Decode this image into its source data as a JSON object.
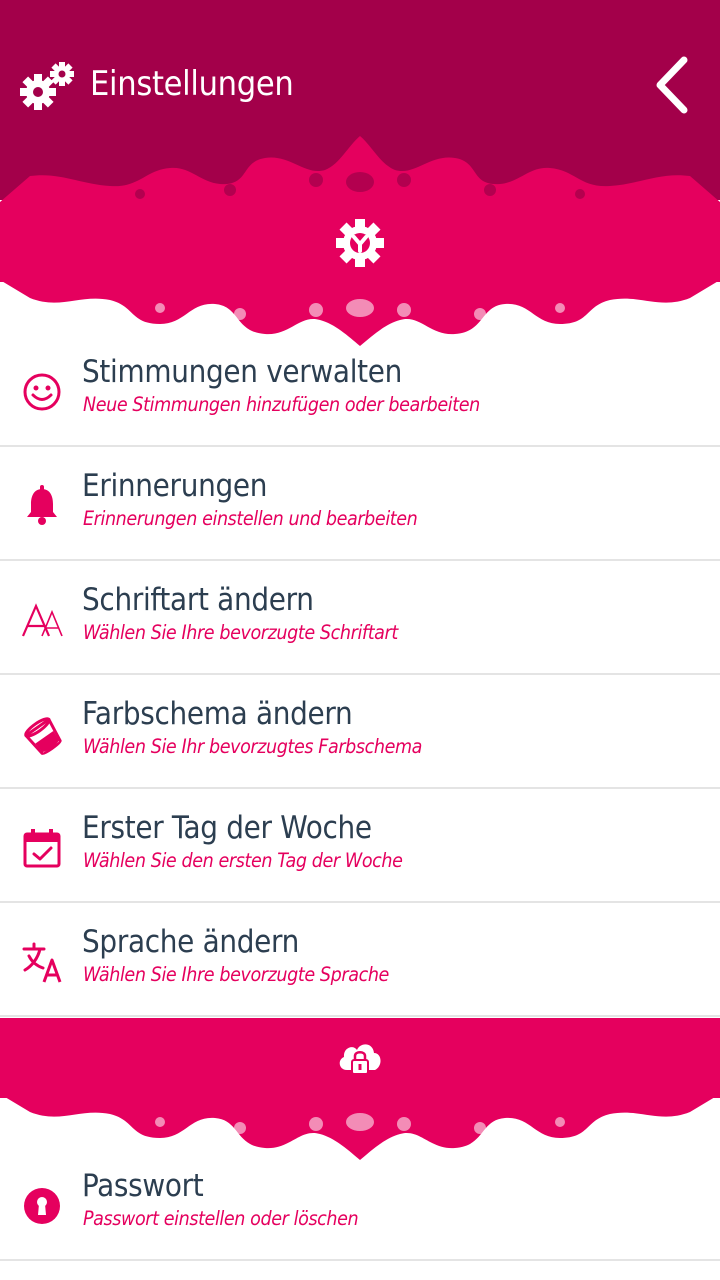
{
  "header": {
    "title": "Einstellungen",
    "bg_color": "#a3004a",
    "icon": "gears-icon",
    "back_icon": "chevron-left-icon"
  },
  "accent_color": "#e5005e",
  "sections": [
    {
      "icon": "settings-wrench-icon"
    },
    {
      "icon": "cloud-lock-icon"
    }
  ],
  "items": [
    {
      "icon": "smiley-icon",
      "title": "Stimmungen verwalten",
      "subtitle": "Neue Stimmungen hinzufügen oder bearbeiten"
    },
    {
      "icon": "bell-icon",
      "title": "Erinnerungen",
      "subtitle": "Erinnerungen einstellen und bearbeiten"
    },
    {
      "icon": "font-icon",
      "title": "Schriftart ändern",
      "subtitle": "Wählen Sie Ihre bevorzugte Schriftart"
    },
    {
      "icon": "paint-bucket-icon",
      "title": "Farbschema ändern",
      "subtitle": "Wählen Sie Ihr bevorzugtes Farbschema"
    },
    {
      "icon": "calendar-check-icon",
      "title": "Erster Tag der Woche",
      "subtitle": "Wählen Sie den ersten Tag der Woche"
    },
    {
      "icon": "translate-icon",
      "title": "Sprache ändern",
      "subtitle": "Wählen Sie Ihre bevorzugte Sprache"
    },
    {
      "icon": "keyhole-icon",
      "title": "Passwort",
      "subtitle": "Passwort einstellen oder löschen"
    }
  ]
}
